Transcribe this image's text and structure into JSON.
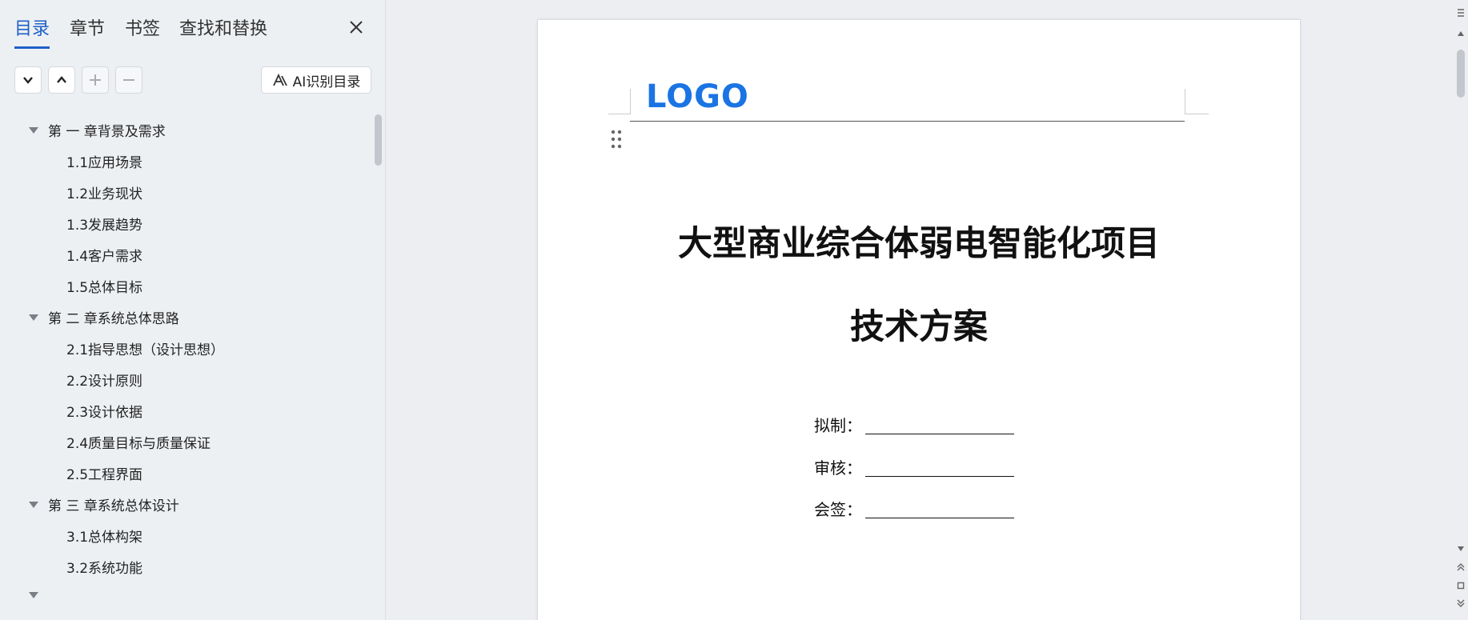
{
  "nav": {
    "tabs": [
      {
        "label": "目录",
        "active": true
      },
      {
        "label": "章节",
        "active": false
      },
      {
        "label": "书签",
        "active": false
      },
      {
        "label": "查找和替换",
        "active": false
      }
    ],
    "ai_button_label": "AI识别目录",
    "toc": [
      {
        "level": 1,
        "label": "第  一  章背景及需求"
      },
      {
        "level": 2,
        "label": "1.1应用场景"
      },
      {
        "level": 2,
        "label": "1.2业务现状"
      },
      {
        "level": 2,
        "label": "1.3发展趋势"
      },
      {
        "level": 2,
        "label": "1.4客户需求"
      },
      {
        "level": 2,
        "label": "1.5总体目标"
      },
      {
        "level": 1,
        "label": "第  二  章系统总体思路"
      },
      {
        "level": 2,
        "label": "2.1指导思想（设计思想）"
      },
      {
        "level": 2,
        "label": "2.2设计原则"
      },
      {
        "level": 2,
        "label": "2.3设计依据"
      },
      {
        "level": 2,
        "label": "2.4质量目标与质量保证"
      },
      {
        "level": 2,
        "label": "2.5工程界面"
      },
      {
        "level": 1,
        "label": "第  三  章系统总体设计"
      },
      {
        "level": 2,
        "label": "3.1总体构架"
      },
      {
        "level": 2,
        "label": "3.2系统功能"
      }
    ]
  },
  "document": {
    "logo_text": "LOGO",
    "title_line1": "大型商业综合体弱电智能化项目",
    "title_line2": "技术方案",
    "signatures": [
      {
        "label": "拟制："
      },
      {
        "label": "审核："
      },
      {
        "label": "会签："
      }
    ]
  },
  "colors": {
    "accent": "#1f5fc8",
    "logo": "#1b74e4"
  }
}
